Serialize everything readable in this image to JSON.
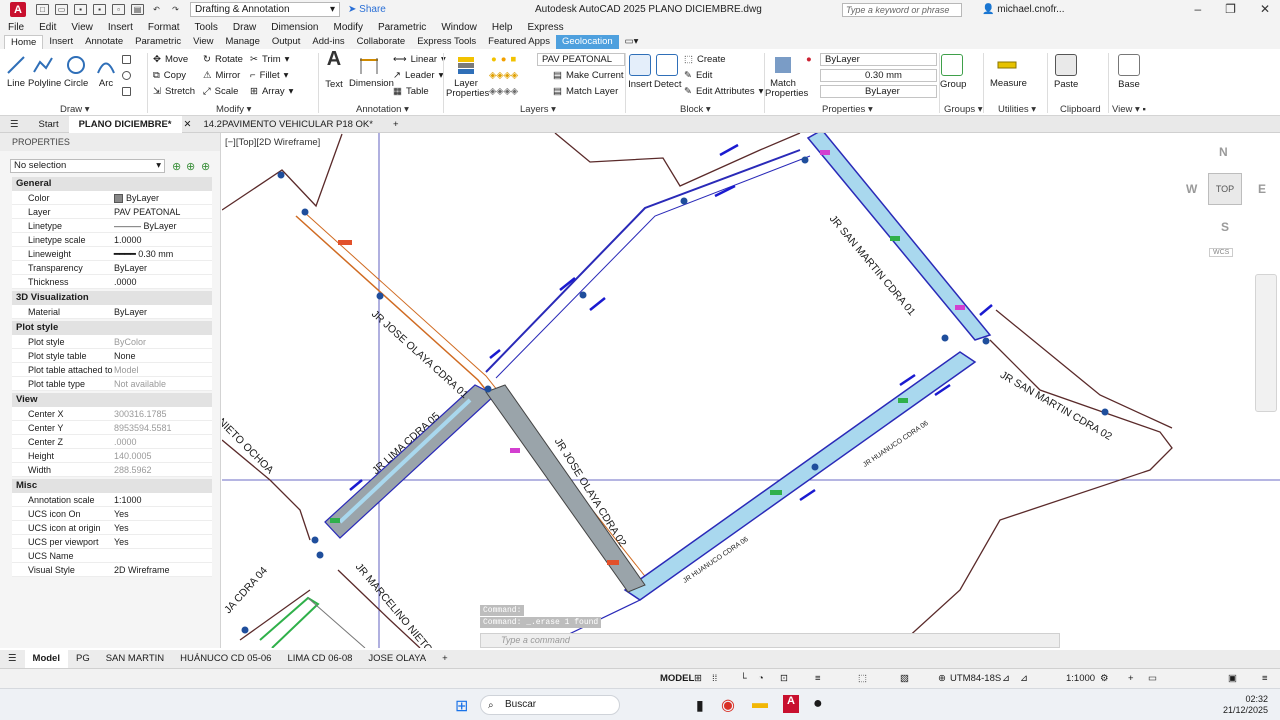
{
  "titlebar": {
    "logo": "A",
    "workspace": "Drafting & Annotation",
    "share": "Share",
    "app_title": "Autodesk AutoCAD 2025   PLANO DICIEMBRE.dwg",
    "search_placeholder": "Type a keyword or phrase",
    "user": "michael.cnofr..."
  },
  "menu": [
    "File",
    "Edit",
    "View",
    "Insert",
    "Format",
    "Tools",
    "Draw",
    "Dimension",
    "Modify",
    "Parametric",
    "Window",
    "Help",
    "Express"
  ],
  "ribbon_tabs": [
    "Home",
    "Insert",
    "Annotate",
    "Parametric",
    "View",
    "Manage",
    "Output",
    "Add-ins",
    "Collaborate",
    "Express Tools",
    "Featured Apps",
    "Geolocation"
  ],
  "ribbon": {
    "draw": {
      "title": "Draw",
      "line": "Line",
      "polyline": "Polyline",
      "circle": "Circle",
      "arc": "Arc"
    },
    "modify": {
      "title": "Modify",
      "move": "Move",
      "rotate": "Rotate",
      "trim": "Trim",
      "copy": "Copy",
      "mirror": "Mirror",
      "fillet": "Fillet",
      "stretch": "Stretch",
      "scale": "Scale",
      "array": "Array"
    },
    "annotation": {
      "title": "Annotation",
      "text": "Text",
      "dimension": "Dimension",
      "linear": "Linear",
      "leader": "Leader",
      "table": "Table"
    },
    "layers": {
      "title": "Layers",
      "layer_properties": "Layer Properties",
      "current_layer": "PAV PEATONAL",
      "make_current": "Make Current",
      "match_layer": "Match Layer"
    },
    "block": {
      "title": "Block",
      "insert": "Insert",
      "detect": "Detect",
      "create": "Create",
      "edit": "Edit",
      "edit_attributes": "Edit Attributes"
    },
    "properties": {
      "title": "Properties",
      "match_properties": "Match Properties",
      "color": "ByLayer",
      "lineweight": "0.30 mm",
      "linetype": "ByLayer"
    },
    "groups": {
      "title": "Groups",
      "group": "Group"
    },
    "utilities": {
      "title": "Utilities",
      "measure": "Measure"
    },
    "clipboard": {
      "title": "Clipboard",
      "paste": "Paste"
    },
    "view": {
      "title": "View",
      "base": "Base"
    }
  },
  "file_tabs": [
    "Start",
    "PLANO DICIEMBRE*",
    "14.2PAVIMENTO VEHICULAR P18 OK*"
  ],
  "properties": {
    "header": "PROPERTIES",
    "selection": "No selection",
    "sections": [
      {
        "title": "General",
        "rows": [
          [
            "Color",
            "ByLayer"
          ],
          [
            "Layer",
            "PAV PEATONAL"
          ],
          [
            "Linetype",
            "ByLayer"
          ],
          [
            "Linetype scale",
            "1.0000"
          ],
          [
            "Lineweight",
            "0.30 mm"
          ],
          [
            "Transparency",
            "ByLayer"
          ],
          [
            "Thickness",
            ".0000"
          ]
        ]
      },
      {
        "title": "3D Visualization",
        "rows": [
          [
            "Material",
            "ByLayer"
          ]
        ]
      },
      {
        "title": "Plot style",
        "rows": [
          [
            "Plot style",
            "ByColor"
          ],
          [
            "Plot style table",
            "None"
          ],
          [
            "Plot table attached to",
            "Model"
          ],
          [
            "Plot table type",
            "Not available"
          ]
        ]
      },
      {
        "title": "View",
        "rows": [
          [
            "Center X",
            "300316.1785"
          ],
          [
            "Center Y",
            "8953594.5581"
          ],
          [
            "Center Z",
            ".0000"
          ],
          [
            "Height",
            "140.0005"
          ],
          [
            "Width",
            "288.5962"
          ]
        ]
      },
      {
        "title": "Misc",
        "rows": [
          [
            "Annotation scale",
            "1:1000"
          ],
          [
            "UCS icon On",
            "Yes"
          ],
          [
            "UCS icon at origin",
            "Yes"
          ],
          [
            "UCS per viewport",
            "Yes"
          ],
          [
            "UCS Name",
            ""
          ],
          [
            "Visual Style",
            "2D Wireframe"
          ]
        ]
      }
    ]
  },
  "viewport": {
    "label": "[−][Top][2D Wireframe]",
    "compass": {
      "n": "N",
      "s": "S",
      "e": "E",
      "w": "W",
      "top": "TOP",
      "wcs": "WCS"
    },
    "streets": [
      "JR JOSE OLAYA CDRA 01",
      "JR SAN MARTIN CDRA 01",
      "JR SAN MARTIN CDRA 02",
      "JR LIMA CDRA 05",
      "JR JOSE OLAYA CDRA 02",
      "JR HUANUCO CDRA 06",
      "JR HUANUCO CDRA 06",
      "JR MARCELINO NIETO CDRA",
      "NIETO OCHOA",
      "JA CDRA 04"
    ]
  },
  "command": {
    "line1": "Command:",
    "line2": "Command: _.erase 1 found",
    "prompt": "Type a command"
  },
  "layout_tabs": [
    "Model",
    "PG",
    "SAN MARTIN",
    "HUÁNUCO CD 05-06",
    "LIMA CD 06-08",
    "JOSE OLAYA"
  ],
  "status": {
    "model": "MODEL",
    "coord": "UTM84-18S",
    "scale": "1:1000"
  },
  "taskbar": {
    "search": "Buscar",
    "time": "02:32",
    "date": "21/12/2025"
  }
}
